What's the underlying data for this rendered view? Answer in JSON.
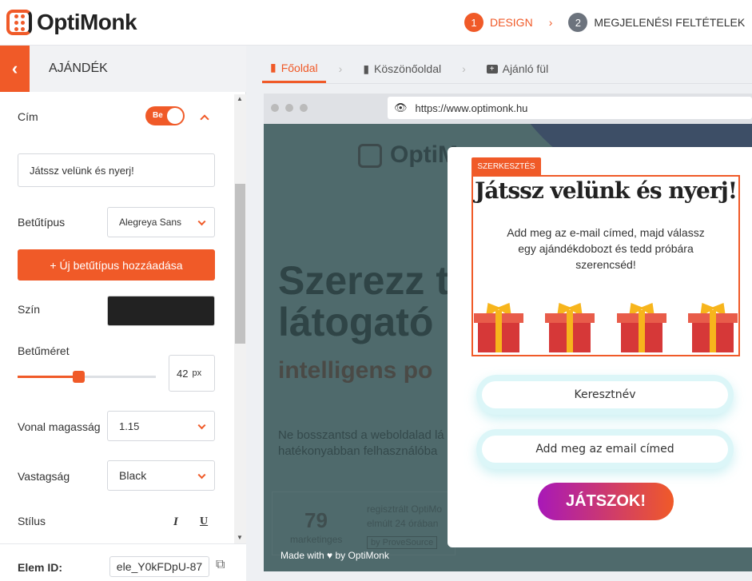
{
  "brand": {
    "name": "OptiMonk",
    "accent": "#f05a28"
  },
  "steps": [
    {
      "num": "1",
      "label": "DESIGN",
      "active": true
    },
    {
      "num": "2",
      "label": "MEGJELENÉSI FELTÉTELEK",
      "active": false
    }
  ],
  "panel": {
    "title": "AJÁNDÉK",
    "section": {
      "label": "Cím",
      "toggle_label": "Be",
      "toggle_on": true
    },
    "title_input": "Játssz velünk és nyerj!",
    "font": {
      "label": "Betűtípus",
      "value": "Alegreya Sans"
    },
    "add_font_button": "+ Új betűtípus hozzáadása",
    "color": {
      "label": "Szín",
      "value": "#222222"
    },
    "font_size": {
      "label": "Betűméret",
      "value": "42",
      "unit": "px",
      "slider_percent": 44
    },
    "line_height": {
      "label": "Vonal magasság",
      "value": "1.15"
    },
    "weight": {
      "label": "Vastagság",
      "value": "Black"
    },
    "style": {
      "label": "Stílus",
      "italic": "I",
      "underline": "U"
    },
    "elem_id": {
      "label": "Elem ID:",
      "value": "ele_Y0kFDpU-87"
    }
  },
  "tabs": [
    {
      "label": "Főoldal",
      "active": true
    },
    {
      "label": "Köszönőoldal",
      "active": false
    },
    {
      "label": "Ajánló fül",
      "active": false
    }
  ],
  "browser": {
    "url": "https://www.optimonk.hu"
  },
  "site": {
    "logo": "OptiM",
    "headline1": "Szerezz t",
    "headline2": "látogató",
    "subhead": "intelligens po",
    "para1": "Ne bosszantsd a weboldalad lá",
    "para2": "hatékonyabban felhasználóba",
    "stat_num": "79",
    "stat_label": "marketinges",
    "stat_text1": "regisztrált OptiMo",
    "stat_text2": "elmúlt 24 órában",
    "proof": "by ProveSource",
    "made_with": "Made with ♥ by OptiMonk"
  },
  "popup": {
    "edit_badge": "SZERKESZTÉS",
    "title": "Játssz velünk és nyerj!",
    "text": "Add meg az e-mail címed, majd válassz egy ajándékdobozt és tedd próbára szerencséd!",
    "gift_count": 4,
    "name_placeholder": "Keresztnév",
    "email_placeholder": "Add meg az email címed",
    "cta": "JÁTSZOK!"
  }
}
